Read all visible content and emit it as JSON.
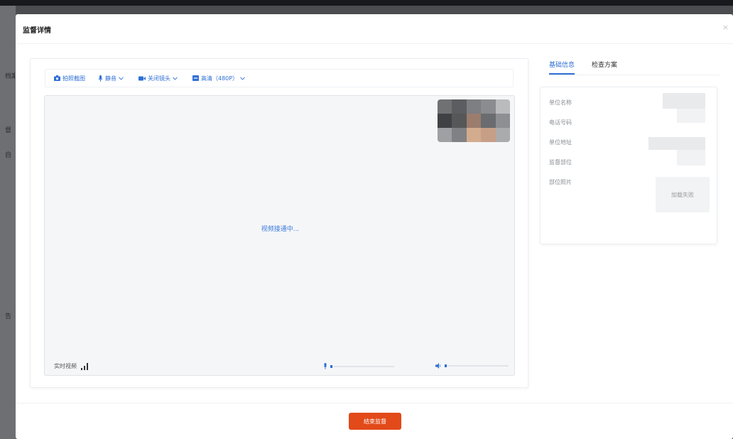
{
  "background": {
    "side_labels": [
      "档案",
      "督",
      "自",
      "告"
    ]
  },
  "modal": {
    "title": "监督详情",
    "close_glyph": "×"
  },
  "toolbar": {
    "screenshot_label": "拍照截图",
    "mute_label": "静音",
    "camera_label": "关闭镜头",
    "quality_label": "高清（480P）"
  },
  "video": {
    "status_text": "视频接通中...",
    "live_label": "实时视频",
    "mic_level": 0.02,
    "speaker_level": 0.02
  },
  "tabs": [
    {
      "label": "基础信息",
      "active": true
    },
    {
      "label": "检查方案",
      "active": false
    }
  ],
  "info": {
    "fields": [
      "单位名称",
      "电话号码",
      "单位地址",
      "监督部位",
      "部位照片"
    ],
    "photo_status": "加载失败"
  },
  "footer": {
    "end_button_label": "结束监督"
  },
  "colors": {
    "accent": "#2f6fd6",
    "danger": "#e24a1a"
  }
}
